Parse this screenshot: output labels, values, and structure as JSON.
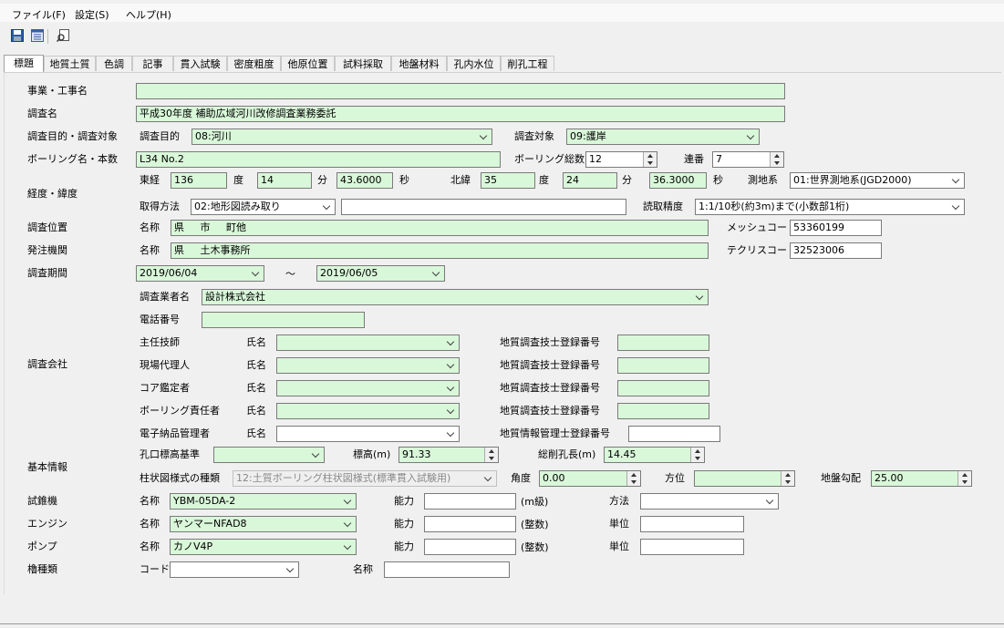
{
  "menu": [
    "ファイル(F)",
    "設定(S)",
    "ヘルプ(H)"
  ],
  "tabs": [
    "標題",
    "地質土質",
    "色調",
    "記事",
    "貫入試験",
    "密度粗度",
    "他原位置",
    "試料採取",
    "地盤材料",
    "孔内水位",
    "削孔工程"
  ],
  "labels": {
    "project": "事業・工事名",
    "survey_name": "調査名",
    "purpose_target": "調査目的・調査対象",
    "purpose": "調査目的",
    "target": "調査対象",
    "boring_name": "ボーリング名・本数",
    "boring_total": "ボーリング総数",
    "serial": "連番",
    "lonlat": "経度・緯度",
    "east": "東経",
    "deg": "度",
    "min": "分",
    "sec": "秒",
    "north": "北緯",
    "geodetic": "測地系",
    "acq_method": "取得方法",
    "read_precision": "読取精度",
    "location": "調査位置",
    "name": "名称",
    "mesh_code": "メッシュコード",
    "orderer": "発注機関",
    "techris_code": "テクリスコード",
    "period": "調査期間",
    "tilde": "～",
    "company": "調査会社",
    "company_name": "調査業者名",
    "phone": "電話番号",
    "chief_engineer": "主任技師",
    "site_agent": "現場代理人",
    "core_appraiser": "コア鑑定者",
    "boring_manager": "ボーリング責任者",
    "e_delivery_manager": "電子納品管理者",
    "person_name": "氏名",
    "geo_engineer_no": "地質調査技士登録番号",
    "geo_info_manager_no": "地質情報管理士登録番号",
    "basic_info": "基本情報",
    "hole_elev_ref": "孔口標高基準",
    "elevation": "標高(m)",
    "total_depth": "総削孔長(m)",
    "column_type": "柱状図様式の種類",
    "angle": "角度",
    "direction": "方位",
    "ground_slope": "地盤勾配",
    "drill": "試錐機",
    "engine": "エンジン",
    "pump": "ポンプ",
    "tower": "櫓種類",
    "capacity": "能力",
    "m_class": "(m級)",
    "integer": "(整数)",
    "method": "方法",
    "unit": "単位",
    "code": "コード"
  },
  "values": {
    "project": "",
    "survey_name": "平成30年度 補助広域河川改修調査業務委託",
    "purpose": "08:河川",
    "target": "09:護岸",
    "boring_name": "L34 No.2",
    "boring_total": "12",
    "serial": "7",
    "lon_deg": "136",
    "lon_min": "14",
    "lon_sec": "43.6000",
    "lat_deg": "35",
    "lat_min": "24",
    "lat_sec": "36.3000",
    "geodetic": "01:世界測地系(JGD2000)",
    "acq_method": "02:地形図読み取り",
    "acq_note": "",
    "read_precision": "1:1/10秒(約3m)まで(小数部1桁)",
    "location_name": "県 市 町他",
    "mesh_code": "53360199",
    "orderer_name": "県 土木事務所",
    "techris_code": "32523006",
    "period_start": "2019/06/04",
    "period_end": "2019/06/05",
    "company_name": "設計株式会社",
    "phone": "",
    "elevation": "91.33",
    "total_depth": "14.45",
    "column_type": "12:土質ボーリング柱状図様式(標準貫入試験用)",
    "angle": "0.00",
    "ground_slope": "25.00",
    "drill_name": "YBM-05DA-2",
    "engine_name": "ヤンマーNFAD8",
    "pump_name": "カノV4P"
  }
}
